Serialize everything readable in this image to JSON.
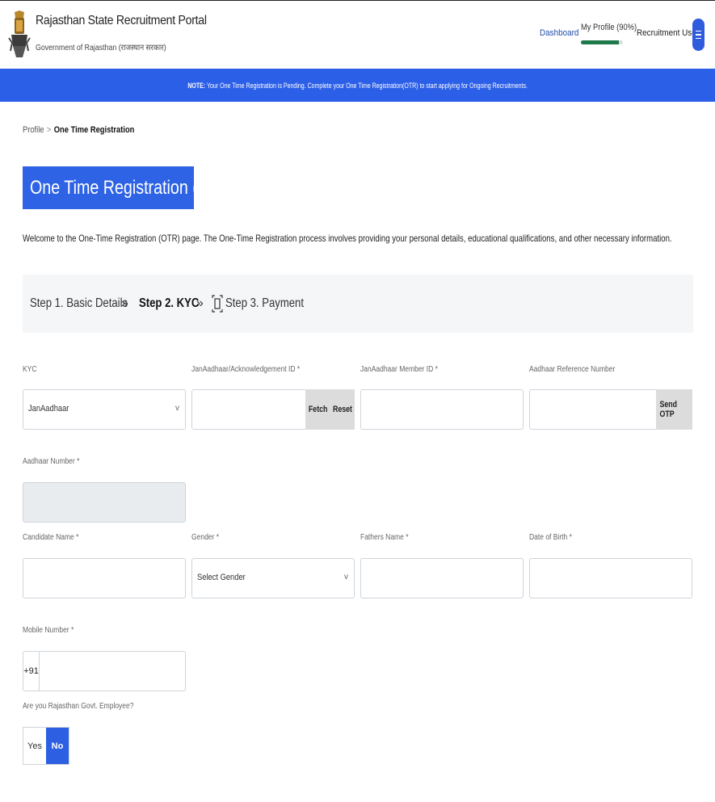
{
  "header": {
    "title": "Rajasthan State Recruitment Portal",
    "subtitle": "Government of Rajasthan (राजस्थान सरकार)",
    "nav": {
      "dashboard": "Dashboard",
      "my_profile": "My Profile (90%)",
      "profile_completion": 0.9,
      "user": "Recruitment User"
    }
  },
  "notice": {
    "prefix": "NOTE:",
    "text": "Your One Time Registration is Pending. Complete your One Time Registration(OTR) to start applying for Ongoing Recruitments."
  },
  "breadcrumb": {
    "parent": "Profile",
    "separator": ">",
    "current": "One Time Registration"
  },
  "page_title": "One Time Registration (OTR)",
  "intro": "Welcome to the One-Time Registration (OTR) page. The One-Time Registration process involves providing your personal details, educational qualifications, and other necessary information.",
  "steps": [
    {
      "label": "Step 1. Basic Details",
      "icon": "person-icon"
    },
    {
      "label": "Step 2. KYC",
      "icon": "face-scan-icon"
    },
    {
      "label": "Step 3. Payment",
      "icon": "payment-scan-icon"
    }
  ],
  "step_separator": "»",
  "form": {
    "kyc": {
      "label": "KYC",
      "value": "JanAadhaar"
    },
    "janaadhaar_ack": {
      "label": "JanAadhaar/Acknowledgement ID *",
      "fetch": "Fetch",
      "reset": "Reset"
    },
    "member_id": {
      "label": "JanAadhaar Member ID *"
    },
    "aadhaar_ref": {
      "label": "Aadhaar Reference Number",
      "send_otp": "Send OTP"
    },
    "aadhaar_number": {
      "label": "Aadhaar Number *"
    },
    "candidate_name": {
      "label": "Candidate Name *"
    },
    "gender": {
      "label": "Gender *",
      "value": "Select Gender"
    },
    "fathers_name": {
      "label": "Fathers Name *"
    },
    "dob": {
      "label": "Date of Birth *"
    },
    "mobile": {
      "label": "Mobile Number *",
      "prefix": "+91"
    },
    "govt_employee": {
      "label": "Are you Rajasthan Govt. Employee?",
      "yes": "Yes",
      "no": "No",
      "selected": "No"
    }
  },
  "colors": {
    "primary": "#2c5fe8",
    "link": "#1e4da8",
    "progress": "#1e7a4a"
  }
}
